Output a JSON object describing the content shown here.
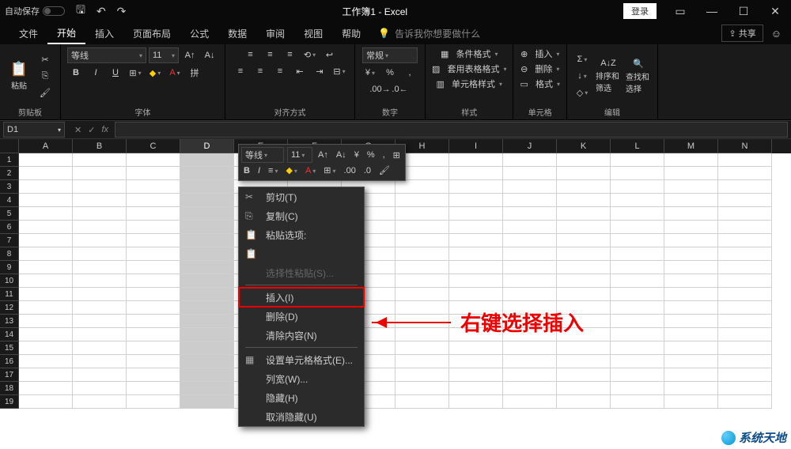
{
  "titlebar": {
    "autosave_label": "自动保存",
    "title": "工作簿1 - Excel",
    "login": "登录"
  },
  "tabs": {
    "file": "文件",
    "home": "开始",
    "insert": "插入",
    "layout": "页面布局",
    "formulas": "公式",
    "data": "数据",
    "review": "审阅",
    "view": "视图",
    "help": "帮助",
    "tellme": "告诉我你想要做什么",
    "share": "共享"
  },
  "ribbon": {
    "clipboard": {
      "label": "剪贴板",
      "paste": "粘贴"
    },
    "font": {
      "label": "字体",
      "name": "等线",
      "size": "11",
      "bold": "B",
      "italic": "I",
      "underline": "U"
    },
    "align": {
      "label": "对齐方式"
    },
    "number": {
      "label": "数字",
      "format": "常规"
    },
    "styles": {
      "label": "样式",
      "cond": "条件格式",
      "table": "套用表格格式",
      "cell": "单元格样式"
    },
    "cells": {
      "label": "单元格",
      "insert": "插入",
      "delete": "删除",
      "format": "格式"
    },
    "editing": {
      "label": "编辑",
      "sort": "排序和筛选",
      "find": "查找和选择"
    }
  },
  "formula_bar": {
    "name_box": "D1",
    "fx": "fx"
  },
  "columns": [
    "A",
    "B",
    "C",
    "D",
    "E",
    "F",
    "G",
    "H",
    "I",
    "J",
    "K",
    "L",
    "M",
    "N"
  ],
  "selected_col_index": 3,
  "rows": [
    1,
    2,
    3,
    4,
    5,
    6,
    7,
    8,
    9,
    10,
    11,
    12,
    13,
    14,
    15,
    16,
    17,
    18,
    19
  ],
  "mini_toolbar": {
    "font": "等线",
    "size": "11",
    "bold": "B",
    "italic": "I"
  },
  "context_menu": {
    "cut": "剪切(T)",
    "copy": "复制(C)",
    "paste_options": "粘贴选项:",
    "paste_special": "选择性粘贴(S)...",
    "insert": "插入(I)",
    "delete": "删除(D)",
    "clear": "清除内容(N)",
    "format_cells": "设置单元格格式(E)...",
    "col_width": "列宽(W)...",
    "hide": "隐藏(H)",
    "unhide": "取消隐藏(U)"
  },
  "annotation": "右键选择插入",
  "watermark": "系统天地"
}
